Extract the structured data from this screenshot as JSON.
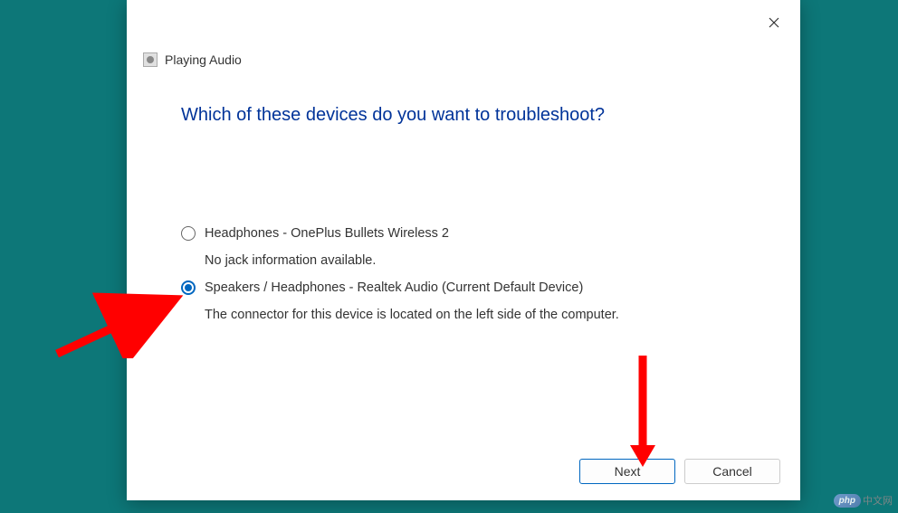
{
  "dialog": {
    "title": "Playing Audio",
    "heading": "Which of these devices do you want to troubleshoot?"
  },
  "devices": [
    {
      "label": "Headphones - OnePlus Bullets Wireless 2",
      "description": "No jack information available.",
      "selected": false
    },
    {
      "label": "Speakers / Headphones - Realtek Audio (Current Default Device)",
      "description": "The connector for this device is located on the left side of the computer.",
      "selected": true
    }
  ],
  "buttons": {
    "next": "Next",
    "cancel": "Cancel"
  },
  "watermark": {
    "logo": "php",
    "text": "中文网"
  },
  "annotation": {
    "arrow_color": "#ff0000"
  }
}
